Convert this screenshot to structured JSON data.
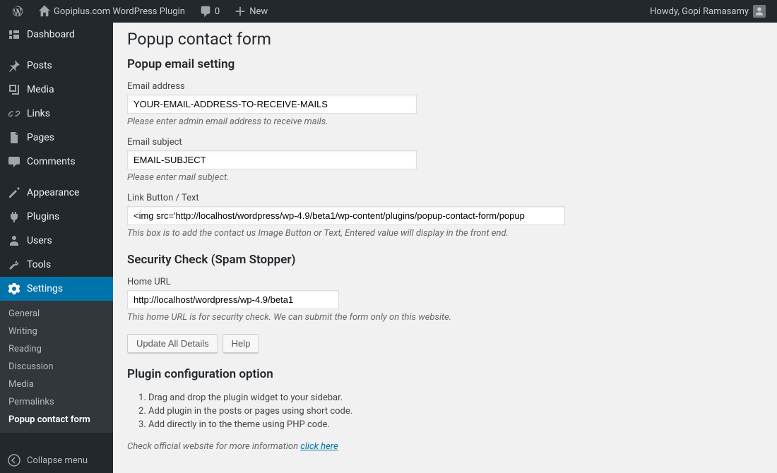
{
  "topbar": {
    "site_name": "Gopiplus.com WordPress Plugin",
    "comments_count": "0",
    "new_label": "New",
    "howdy": "Howdy, Gopi Ramasamy"
  },
  "sidebar": {
    "items": [
      {
        "label": "Dashboard"
      },
      {
        "label": "Posts"
      },
      {
        "label": "Media"
      },
      {
        "label": "Links"
      },
      {
        "label": "Pages"
      },
      {
        "label": "Comments"
      },
      {
        "label": "Appearance"
      },
      {
        "label": "Plugins"
      },
      {
        "label": "Users"
      },
      {
        "label": "Tools"
      },
      {
        "label": "Settings"
      }
    ],
    "submenu": [
      {
        "label": "General"
      },
      {
        "label": "Writing"
      },
      {
        "label": "Reading"
      },
      {
        "label": "Discussion"
      },
      {
        "label": "Media"
      },
      {
        "label": "Permalinks"
      },
      {
        "label": "Popup contact form"
      }
    ],
    "collapse": "Collapse menu"
  },
  "page": {
    "title": "Popup contact form",
    "section1": "Popup email setting",
    "email_label": "Email address",
    "email_value": "YOUR-EMAIL-ADDRESS-TO-RECEIVE-MAILS",
    "email_desc": "Please enter admin email address to receive mails.",
    "subject_label": "Email subject",
    "subject_value": "EMAIL-SUBJECT",
    "subject_desc": "Please enter mail subject.",
    "link_label": "Link Button / Text",
    "link_value": "<img src='http://localhost/wordpress/wp-4.9/beta1/wp-content/plugins/popup-contact-form/popup",
    "link_desc": "This box is to add the contact us Image Button or Text, Entered value will display in the front end.",
    "section2": "Security Check (Spam Stopper)",
    "home_label": "Home URL",
    "home_value": "http://localhost/wordpress/wp-4.9/beta1",
    "home_desc": "This home URL is for security check. We can submit the form only on this website.",
    "btn_update": "Update All Details",
    "btn_help": "Help",
    "section3": "Plugin configuration option",
    "config": [
      "Drag and drop the plugin widget to your sidebar.",
      "Add plugin in the posts or pages using short code.",
      "Add directly in to the theme using PHP code."
    ],
    "footer_text": "Check official website for more information ",
    "footer_link": "click here"
  }
}
